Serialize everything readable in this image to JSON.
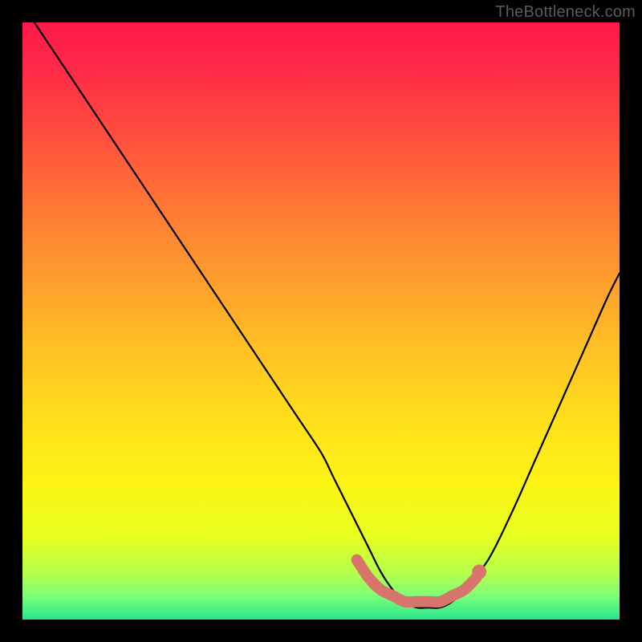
{
  "watermark": "TheBottleneck.com",
  "gradient": {
    "stops": [
      {
        "offset": 0.0,
        "color": "#ff174a"
      },
      {
        "offset": 0.08,
        "color": "#ff2b47"
      },
      {
        "offset": 0.18,
        "color": "#ff4b3f"
      },
      {
        "offset": 0.3,
        "color": "#ff7536"
      },
      {
        "offset": 0.42,
        "color": "#ff9a2e"
      },
      {
        "offset": 0.55,
        "color": "#ffc224"
      },
      {
        "offset": 0.68,
        "color": "#ffe31a"
      },
      {
        "offset": 0.78,
        "color": "#fbf514"
      },
      {
        "offset": 0.86,
        "color": "#e7ff20"
      },
      {
        "offset": 0.92,
        "color": "#b7ff49"
      },
      {
        "offset": 0.96,
        "color": "#7dff77"
      },
      {
        "offset": 1.0,
        "color": "#28e68f"
      }
    ]
  },
  "chart_data": {
    "type": "line",
    "title": "",
    "xlabel": "",
    "ylabel": "",
    "xlim": [
      0,
      100
    ],
    "ylim": [
      0,
      100
    ],
    "series": [
      {
        "name": "bottleneck-curve",
        "x": [
          2,
          6,
          10,
          14,
          18,
          22,
          26,
          30,
          34,
          38,
          42,
          46,
          50,
          52,
          54,
          56,
          58,
          60,
          62,
          64,
          66,
          68,
          70,
          72,
          74,
          78,
          82,
          86,
          90,
          94,
          98,
          100
        ],
        "y": [
          100,
          94,
          88,
          82,
          76,
          70,
          64,
          58,
          52,
          46,
          40,
          34,
          28,
          24,
          20,
          16,
          12,
          8,
          5,
          3,
          2,
          2,
          2,
          3,
          5,
          10,
          18,
          27,
          36,
          45,
          54,
          58
        ]
      }
    ],
    "emphasis": {
      "name": "optimal-zone",
      "x": [
        56,
        58,
        60,
        62,
        64,
        66,
        68,
        70,
        72,
        74,
        76
      ],
      "y": [
        10,
        7,
        5,
        4,
        3,
        3,
        3,
        3,
        4,
        5,
        7
      ]
    },
    "emphasis_dot": {
      "x": 76.5,
      "y": 8
    }
  }
}
